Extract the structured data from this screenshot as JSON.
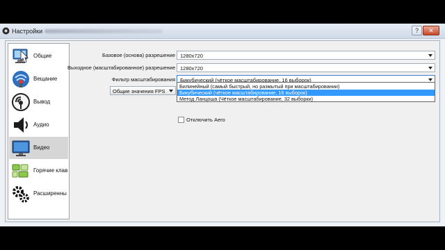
{
  "window": {
    "title": "Настройки"
  },
  "sidebar": {
    "items": [
      {
        "label": "Общие",
        "icon": "general-icon",
        "selected": false
      },
      {
        "label": "Вещание",
        "icon": "broadcast-icon",
        "selected": false
      },
      {
        "label": "Вывод",
        "icon": "output-icon",
        "selected": false
      },
      {
        "label": "Аудио",
        "icon": "speaker-icon",
        "selected": false
      },
      {
        "label": "Видео",
        "icon": "monitor-icon",
        "selected": true
      },
      {
        "label": "Горячие клав",
        "icon": "keyboard-icon",
        "selected": false
      },
      {
        "label": "Расширенны",
        "icon": "gears-icon",
        "selected": false
      }
    ]
  },
  "video": {
    "base_resolution": {
      "label": "Базовое (основа) разрешение",
      "value": "1280x720"
    },
    "output_resolution": {
      "label": "Выходное (масштабированное) разрешение",
      "value": "1280x720"
    },
    "downscale_filter": {
      "label": "Фильтр масштабирования",
      "value": "Бикубический (чёткое масштабирование, 16 выборок)",
      "options": [
        "Билинейный (самый быстрый, но размытый при масштабировании)",
        "Бикубический (чёткое масштабирование, 16 выборок)",
        "Метод Ланцоша (Чёткое масштабирование, 32 выборки)"
      ],
      "selected_index": 1
    },
    "fps_type": {
      "value": "Общие значения FPS"
    },
    "disable_aero": {
      "label": "Отключить Aero",
      "checked": false
    }
  },
  "colors": {
    "selection": "#3399ff",
    "sidebar_selected": "#d6d6d6"
  }
}
